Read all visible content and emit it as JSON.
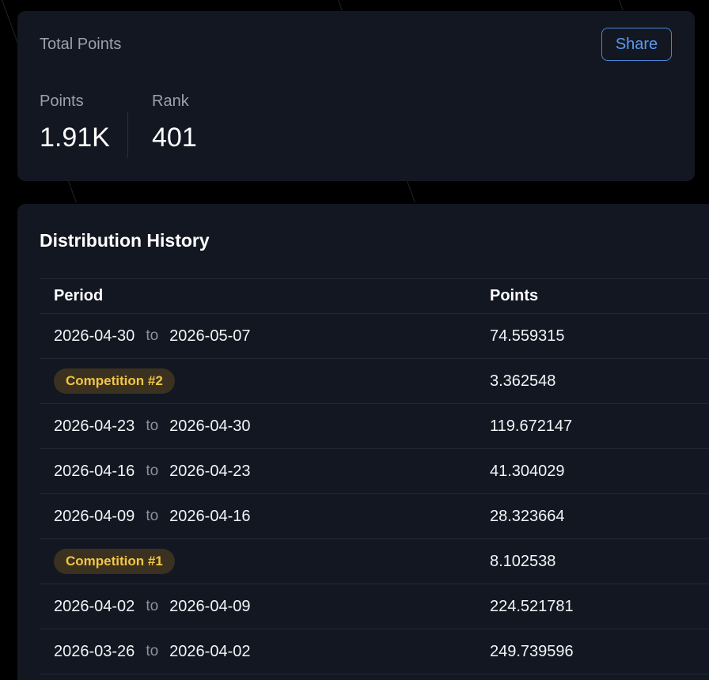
{
  "total_points_card": {
    "title": "Total Points",
    "share_label": "Share",
    "points_label": "Points",
    "points_value": "1.91K",
    "rank_label": "Rank",
    "rank_value": "401"
  },
  "distribution": {
    "title": "Distribution History",
    "columns": [
      "Period",
      "Points"
    ],
    "separator": "to",
    "rows": [
      {
        "type": "range",
        "start": "2026-04-30",
        "end": "2026-05-07",
        "points": "74.559315"
      },
      {
        "type": "competition",
        "label": "Competition #2",
        "points": "3.362548"
      },
      {
        "type": "range",
        "start": "2026-04-23",
        "end": "2026-04-30",
        "points": "119.672147"
      },
      {
        "type": "range",
        "start": "2026-04-16",
        "end": "2026-04-23",
        "points": "41.304029"
      },
      {
        "type": "range",
        "start": "2026-04-09",
        "end": "2026-04-16",
        "points": "28.323664"
      },
      {
        "type": "competition",
        "label": "Competition #1",
        "points": "8.102538"
      },
      {
        "type": "range",
        "start": "2026-04-02",
        "end": "2026-04-09",
        "points": "224.521781"
      },
      {
        "type": "range",
        "start": "2026-03-26",
        "end": "2026-04-02",
        "points": "249.739596"
      }
    ]
  },
  "colors": {
    "background": "#000000",
    "card": "#131722",
    "accent": "#5b9aee",
    "badge_text": "#f3c544",
    "badge_bg": "#3a3120"
  }
}
